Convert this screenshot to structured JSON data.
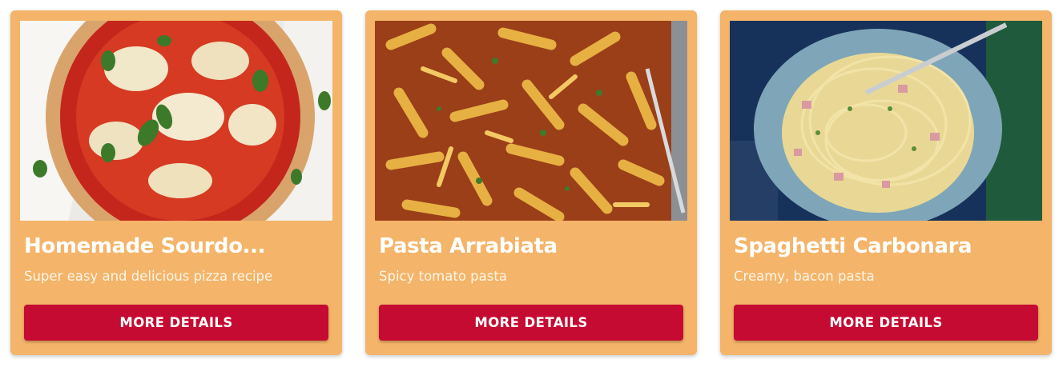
{
  "colors": {
    "card_background": "#f4b469",
    "button_background": "#c50b32"
  },
  "cards": [
    {
      "title": "Homemade Sourdo...",
      "description": "Super easy and delicious pizza recipe",
      "button_label": "MORE DETAILS",
      "image": "sourdough-pizza-photo"
    },
    {
      "title": "Pasta Arrabiata",
      "description": "Spicy tomato pasta",
      "button_label": "MORE DETAILS",
      "image": "penne-arrabiata-photo"
    },
    {
      "title": "Spaghetti Carbonara",
      "description": "Creamy, bacon pasta",
      "button_label": "MORE DETAILS",
      "image": "spaghetti-carbonara-photo"
    }
  ]
}
